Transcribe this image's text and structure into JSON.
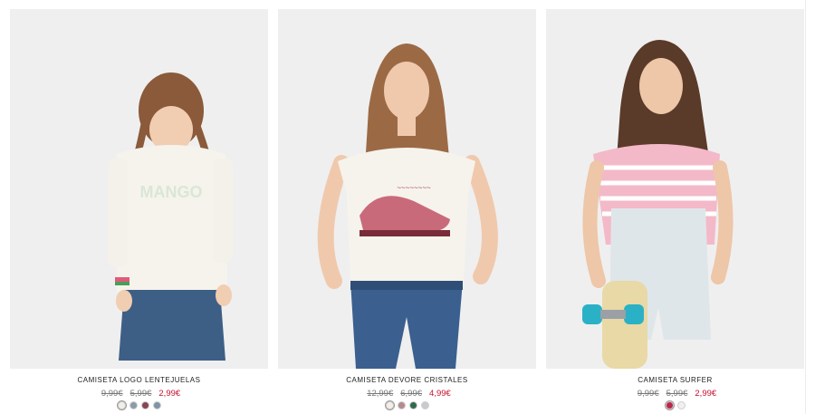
{
  "products": [
    {
      "name": "CAMISETA LOGO LENTEJUELAS",
      "old_prices": [
        "9,99€",
        "5,99€"
      ],
      "sale_price": "2,99€",
      "colors": [
        "#f3efe6",
        "#8d9aa8",
        "#8a4455",
        "#7f94a6"
      ],
      "photo_icon": "girl-white-sweater-photo"
    },
    {
      "name": "CAMISETA DEVORE CRISTALES",
      "old_prices": [
        "12,99€",
        "6,99€"
      ],
      "sale_price": "4,99€",
      "colors": [
        "#f3efe6",
        "#b48b8f",
        "#2f6b4a",
        "#c9c9cf"
      ],
      "photo_icon": "girl-white-tee-photo"
    },
    {
      "name": "CAMISETA SURFER",
      "old_prices": [
        "9,99€",
        "5,99€"
      ],
      "sale_price": "2,99€",
      "colors": [
        "#c0254a",
        "#f0f0f0"
      ],
      "photo_icon": "girl-skateboard-photo"
    }
  ],
  "colors": {
    "sale": "#c8102e",
    "photo_bg": "#efefef",
    "text": "#222222"
  }
}
